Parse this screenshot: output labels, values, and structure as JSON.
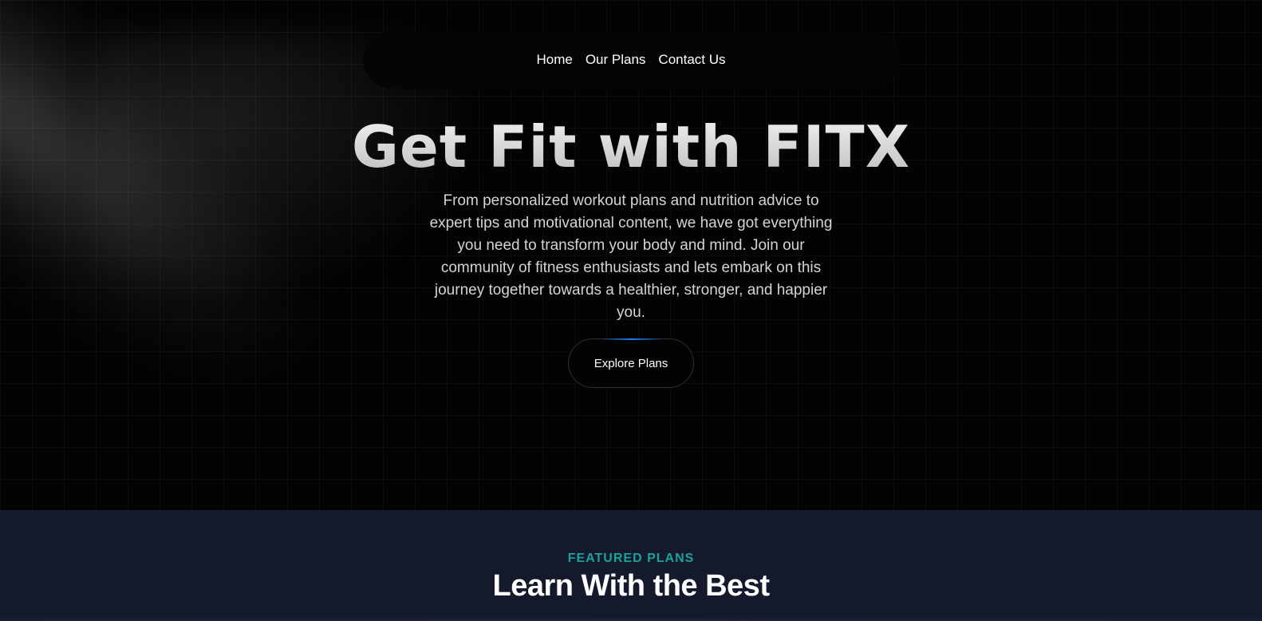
{
  "nav": {
    "items": [
      {
        "label": "Home"
      },
      {
        "label": "Our Plans"
      },
      {
        "label": "Contact Us"
      }
    ]
  },
  "hero": {
    "title": "Get Fit with FITX",
    "description": "From personalized workout plans and nutrition advice to expert tips and motivational content, we have got everything you need to transform your body and mind. Join our community of fitness enthusiasts and lets embark on this journey together towards a healthier, stronger, and happier you.",
    "cta_label": "Explore Plans"
  },
  "featured": {
    "eyebrow": "FEATURED PLANS",
    "title": "Learn With the Best"
  },
  "colors": {
    "accent_teal": "#1aa39b",
    "button_glow": "#1e7bff",
    "section_bg": "#141a2b",
    "hero_bg": "#030303"
  }
}
